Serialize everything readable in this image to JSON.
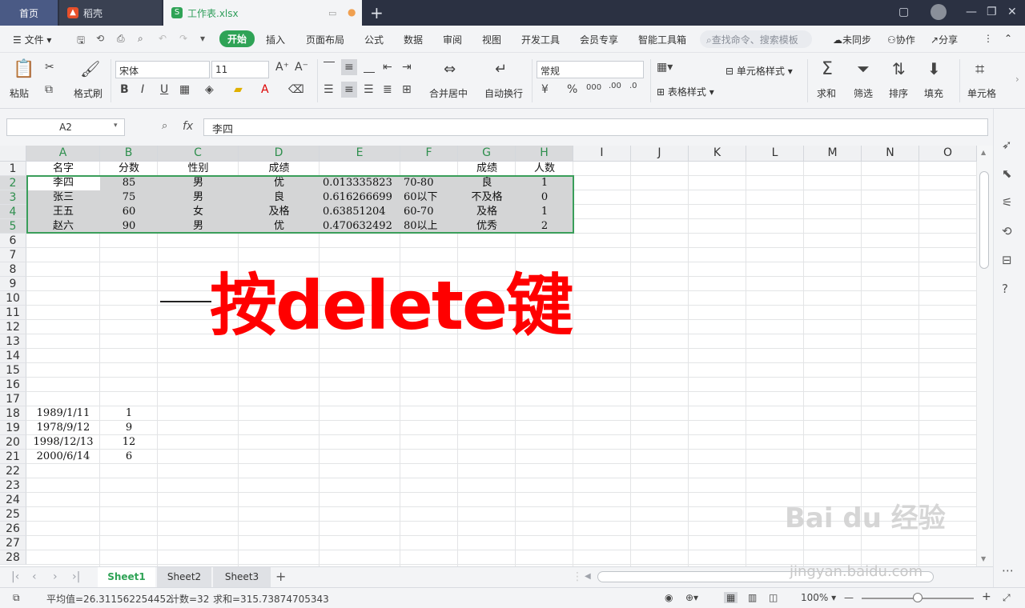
{
  "titlebar": {
    "tabs": [
      {
        "label": "首页"
      },
      {
        "label": "稻壳"
      },
      {
        "label": "工作表.xlsx"
      }
    ]
  },
  "menubar": {
    "file": "文件",
    "items": [
      "开始",
      "插入",
      "页面布局",
      "公式",
      "数据",
      "审阅",
      "视图",
      "开发工具",
      "会员专享",
      "智能工具箱"
    ],
    "search_placeholder": "查找命令、搜索模板",
    "sync": "未同步",
    "collab": "协作",
    "share": "分享"
  },
  "ribbon": {
    "paste": "粘贴",
    "format_painter": "格式刷",
    "font_name": "宋体",
    "font_size": "11",
    "merge_center": "合并居中",
    "auto_wrap": "自动换行",
    "number_format": "常规",
    "cell_style": "单元格样式",
    "table_style": "表格样式",
    "sum": "求和",
    "filter": "筛选",
    "sort": "排序",
    "fill": "填充",
    "cell": "单元格"
  },
  "formula_bar": {
    "name_box": "A2",
    "fx": "fx",
    "content": "李四"
  },
  "grid": {
    "columns": [
      "A",
      "B",
      "C",
      "D",
      "E",
      "F",
      "G",
      "H",
      "I",
      "J",
      "K",
      "L",
      "M",
      "N",
      "O"
    ],
    "rows": [
      "1",
      "2",
      "3",
      "4",
      "5",
      "6",
      "7",
      "8",
      "9",
      "10",
      "11",
      "12",
      "13",
      "14",
      "15",
      "16",
      "17",
      "18",
      "19",
      "20",
      "21",
      "22",
      "23",
      "24",
      "25",
      "26",
      "27",
      "28"
    ],
    "data": {
      "A1": "名字",
      "B1": "分数",
      "C1": "性别",
      "D1": "成绩",
      "G1": "成绩",
      "H1": "人数",
      "A2": "李四",
      "B2": "85",
      "C2": "男",
      "D2": "优",
      "E2": "0.013335823",
      "F2": "70-80",
      "G2": "良",
      "H2": "1",
      "A3": "张三",
      "B3": "75",
      "C3": "男",
      "D3": "良",
      "E3": "0.616266699",
      "F3": "60以下",
      "G3": "不及格",
      "H3": "0",
      "A4": "王五",
      "B4": "60",
      "C4": "女",
      "D4": "及格",
      "E4": "0.63851204",
      "F4": "60-70",
      "G4": "及格",
      "H4": "1",
      "A5": "赵六",
      "B5": "90",
      "C5": "男",
      "D5": "优",
      "E5": "0.470632492",
      "F5": "80以上",
      "G5": "优秀",
      "H5": "2",
      "A18": "1989/1/11",
      "B18": "1",
      "A19": "1978/9/12",
      "B19": "9",
      "A20": "1998/12/13",
      "B20": "12",
      "A21": "2000/6/14",
      "B21": "6"
    },
    "annotation": "按delete键"
  },
  "sheets": [
    "Sheet1",
    "Sheet2",
    "Sheet3"
  ],
  "status": {
    "average": "平均值=26.311562254452",
    "count": "计数=32",
    "sum": "求和=315.73874705343",
    "zoom": "100%"
  },
  "watermark": {
    "line1": "Bai du 经验",
    "line2": "jingyan.baidu.com"
  },
  "colors": {
    "accent": "#2fa356",
    "selection_border": "#3a9e5a",
    "annotation": "#ff0000"
  }
}
